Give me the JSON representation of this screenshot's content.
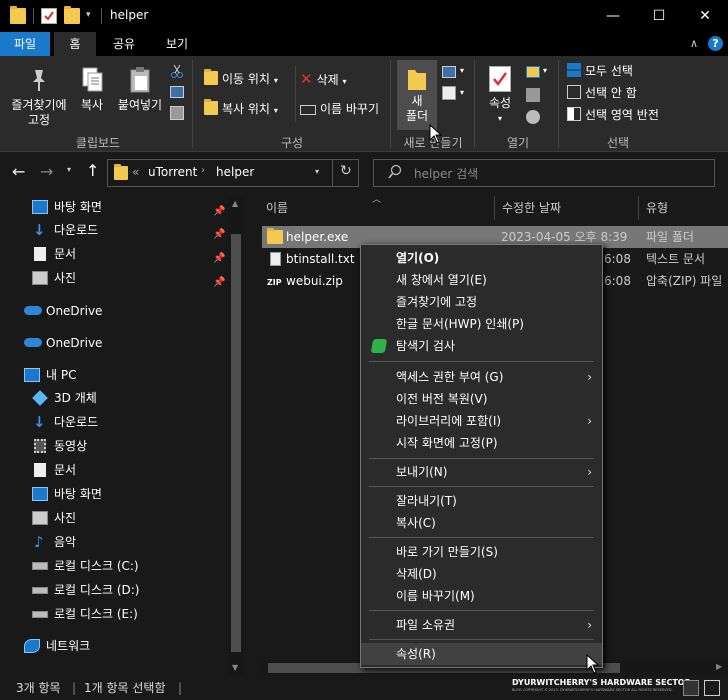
{
  "window": {
    "title": "helper",
    "minimize": "—",
    "maximize": "☐",
    "close": "✕"
  },
  "ribbon_tabs": [
    {
      "label": "파일"
    },
    {
      "label": "홈"
    },
    {
      "label": "공유"
    },
    {
      "label": "보기"
    }
  ],
  "ribbon": {
    "pin_to_quick": "즐겨찾기에\n고정",
    "copy": "복사",
    "paste": "붙여넣기",
    "clipboard_group": "클립보드",
    "move_to": "이동 위치",
    "copy_to": "복사 위치",
    "delete": "삭제",
    "rename": "이름 바꾸기",
    "organize_group": "구성",
    "new_folder": "새\n폴더",
    "new_group": "새로 만들기",
    "properties": "속성",
    "open_group": "열기",
    "select_all": "모두 선택",
    "select_none": "선택 안 함",
    "invert_selection": "선택 영역 반전",
    "select_group": "선택"
  },
  "nav": {
    "breadcrumb_sep": "«",
    "crumbs": [
      "uTorrent",
      "helper"
    ],
    "search_placeholder": "helper 검색"
  },
  "sidebar": [
    {
      "label": "바탕 화면",
      "pinned": true
    },
    {
      "label": "다운로드",
      "pinned": true
    },
    {
      "label": "문서",
      "pinned": true
    },
    {
      "label": "사진",
      "pinned": true
    },
    {
      "label": "OneDrive"
    },
    {
      "label": "OneDrive"
    },
    {
      "label": "내 PC"
    },
    {
      "label": "3D 개체"
    },
    {
      "label": "다운로드"
    },
    {
      "label": "동영상"
    },
    {
      "label": "문서"
    },
    {
      "label": "바탕 화면"
    },
    {
      "label": "사진"
    },
    {
      "label": "음악"
    },
    {
      "label": "로컬 디스크 (C:)"
    },
    {
      "label": "로컬 디스크 (D:)"
    },
    {
      "label": "로컬 디스크 (E:)"
    },
    {
      "label": "네트워크"
    }
  ],
  "columns": {
    "name": "이름",
    "date": "수정한 날짜",
    "type": "유형"
  },
  "files": [
    {
      "name": "helper.exe",
      "date": "2023-04-05 오후 8:39",
      "type": "파일 폴더"
    },
    {
      "name": "btinstall.txt",
      "date_tail": "6:08",
      "type": "텍스트 문서"
    },
    {
      "name": "webui.zip",
      "date_tail": "6:08",
      "type": "압축(ZIP) 파일"
    }
  ],
  "context_menu": [
    {
      "label": "열기(O)"
    },
    {
      "label": "새 창에서 열기(E)"
    },
    {
      "label": "즐겨찾기에 고정"
    },
    {
      "label": "한글 문서(HWP) 인쇄(P)"
    },
    {
      "label": "탐색기 검사"
    },
    {
      "label": "액세스 권한 부여 (G)",
      "submenu": true
    },
    {
      "label": "이전 버전 복원(V)"
    },
    {
      "label": "라이브러리에 포함(I)",
      "submenu": true
    },
    {
      "label": "시작 화면에 고정(P)"
    },
    {
      "label": "보내기(N)",
      "submenu": true
    },
    {
      "label": "잘라내기(T)"
    },
    {
      "label": "복사(C)"
    },
    {
      "label": "바로 가기 만들기(S)"
    },
    {
      "label": "삭제(D)"
    },
    {
      "label": "이름 바꾸기(M)"
    },
    {
      "label": "파일 소유권",
      "submenu": true
    },
    {
      "label": "속성(R)"
    }
  ],
  "status": {
    "count": "3개 항목",
    "selected": "1개 항목 선택함",
    "sep": "|"
  },
  "watermark": {
    "title": "DYURWITCHERRY'S HARDWARE SECTOR",
    "sub": "BLOG COPYRIGHT © 2013. DYURWITCHERRY'S HARDWARE SECTOR ALL RIGHTS RESERVED."
  },
  "colors": {
    "accent": "#1979ca",
    "folder": "#f3c94f",
    "onedrive": "#2b88d8"
  }
}
